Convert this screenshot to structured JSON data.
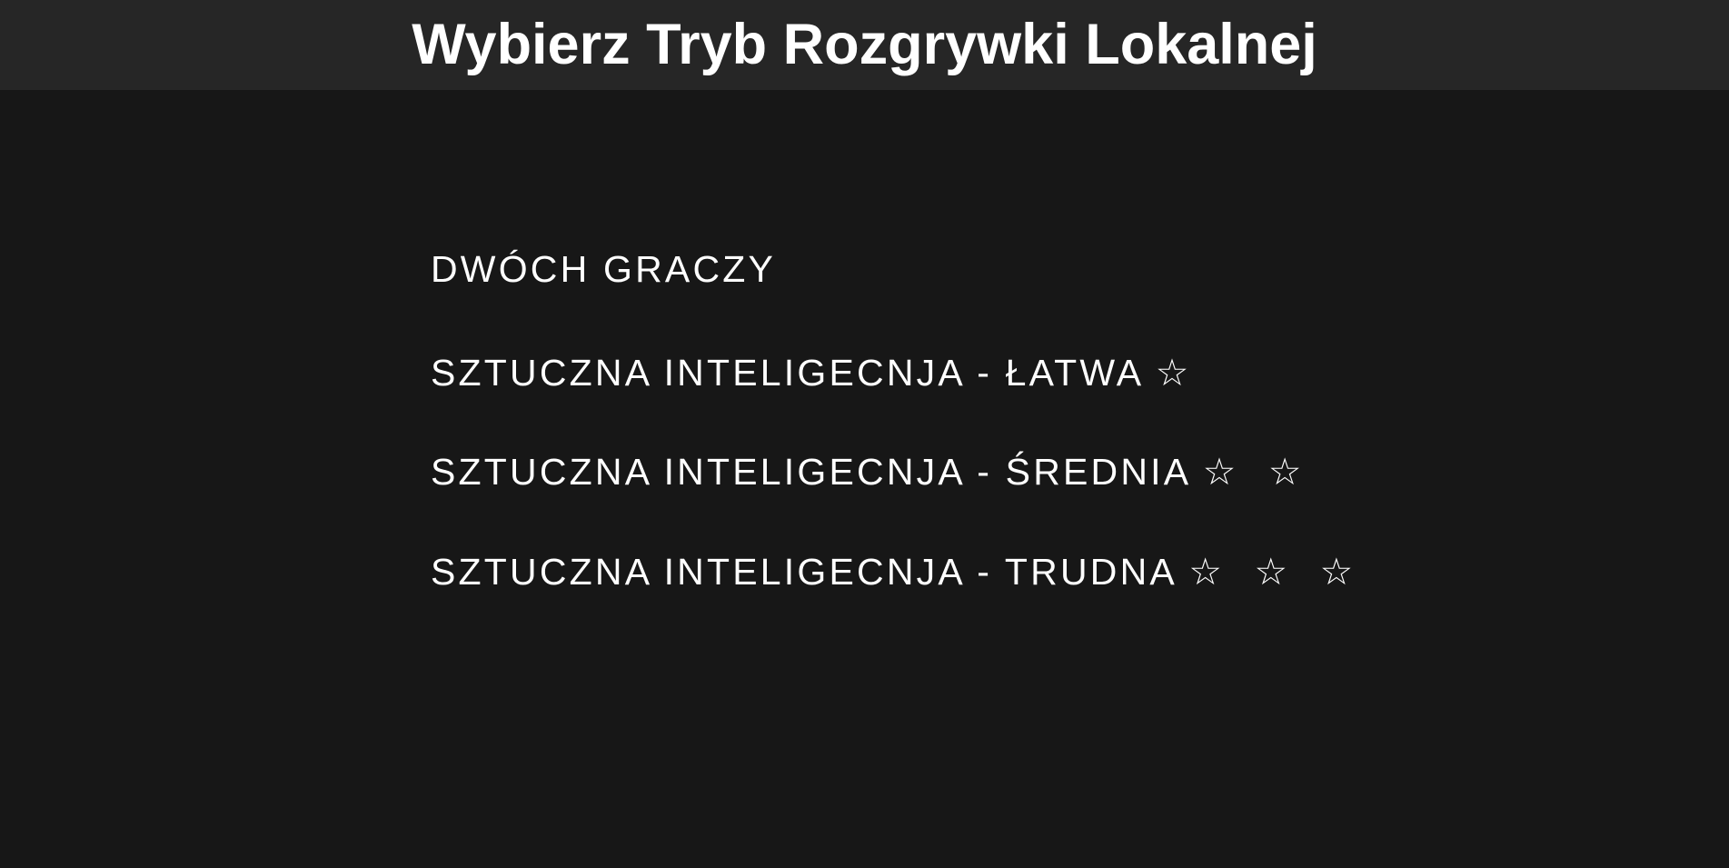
{
  "header": {
    "title": "Wybierz Tryb Rozgrywki Lokalnej"
  },
  "menu": {
    "options": [
      {
        "label": "DWÓCH GRACZY",
        "stars": ""
      },
      {
        "label": "SZTUCZNA INTELIGECNJA - ŁATWA",
        "stars": "☆"
      },
      {
        "label": "SZTUCZNA INTELIGECNJA - ŚREDNIA",
        "stars": "☆ ☆"
      },
      {
        "label": "SZTUCZNA INTELIGECNJA - TRUDNA",
        "stars": "☆ ☆ ☆"
      }
    ]
  },
  "colors": {
    "background": "#171717",
    "header_background": "#262626",
    "text": "#ffffff"
  }
}
